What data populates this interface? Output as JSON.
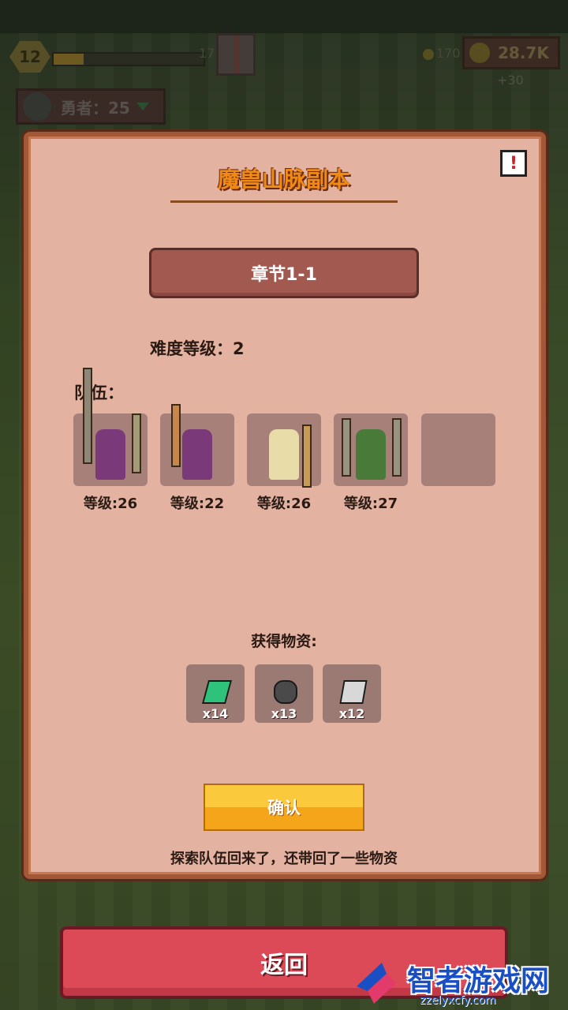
{
  "hud": {
    "level": "12",
    "xp_text": "17",
    "gold_small": "170",
    "gold": "28.7K",
    "gold_rate": "+30",
    "hero_count": "勇者：25"
  },
  "dialog": {
    "title": "魔兽山脉副本",
    "chapter": "章节1-1",
    "difficulty": "难度等级：2",
    "team_label": "队伍：",
    "team": [
      {
        "level": "等级:26",
        "hero": "purple-warrior-axe",
        "color": "#7a3a7a"
      },
      {
        "level": "等级:22",
        "hero": "purple-warrior-sword",
        "color": "#7a3a7a"
      },
      {
        "level": "等级:26",
        "hero": "blonde-archer",
        "color": "#e8dca8"
      },
      {
        "level": "等级:27",
        "hero": "green-orc-dual-swords",
        "color": "#4a7a3a"
      }
    ],
    "rewards_label": "获得物资:",
    "rewards": [
      {
        "qty": "x14",
        "item": "emerald-gem",
        "color": "#2ec27a"
      },
      {
        "qty": "x13",
        "item": "iron-ore",
        "color": "#4a4a4a"
      },
      {
        "qty": "x12",
        "item": "silver-ingot",
        "color": "#d8d8d8"
      }
    ],
    "confirm_label": "确认",
    "message": "探索队伍回来了，还带回了一些物资"
  },
  "back_label": "返回",
  "watermark": {
    "name": "智者游戏网",
    "url": "zzelyxcfy.com"
  }
}
